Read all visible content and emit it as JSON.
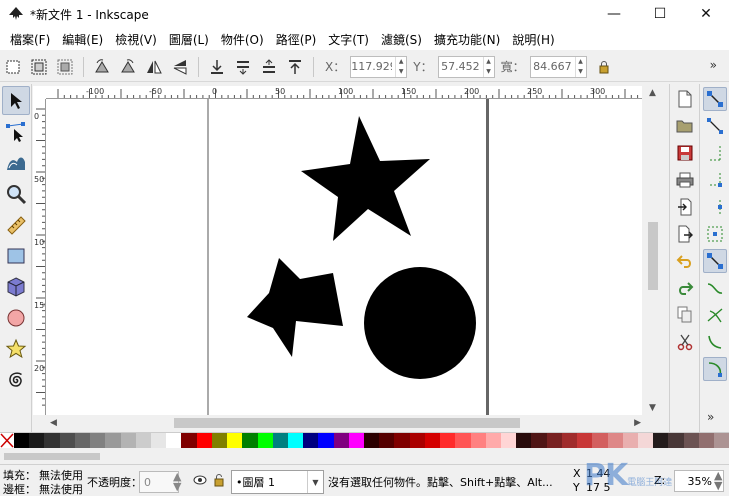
{
  "window": {
    "title": "*新文件 1 - Inkscape",
    "minimize_glyph": "—",
    "maximize_glyph": "☐",
    "close_glyph": "✕"
  },
  "menu": {
    "items": [
      {
        "label": "檔案(F)"
      },
      {
        "label": "編輯(E)"
      },
      {
        "label": "檢視(V)"
      },
      {
        "label": "圖層(L)"
      },
      {
        "label": "物件(O)"
      },
      {
        "label": "路徑(P)"
      },
      {
        "label": "文字(T)"
      },
      {
        "label": "濾鏡(S)"
      },
      {
        "label": "擴充功能(N)"
      },
      {
        "label": "說明(H)"
      }
    ]
  },
  "toolbar": {
    "x_label": "X：",
    "x_value": "117.929",
    "y_label": "Y：",
    "y_value": "57.452",
    "w_label": "寬：",
    "w_value": "84.667",
    "more": "»",
    "icons": [
      "select-all-icon",
      "select-all-layers-icon",
      "deselect-icon",
      "rotate-ccw-icon",
      "rotate-cw-icon",
      "flip-horizontal-icon",
      "flip-vertical-icon",
      "lower-to-bottom-icon",
      "lower-icon",
      "raise-icon",
      "raise-to-top-icon",
      "lock-icon"
    ]
  },
  "ruler": {
    "h_labels": [
      "-100",
      "-50",
      "0",
      "50",
      "100",
      "150",
      "200",
      "250",
      "300"
    ],
    "v_labels": [
      "0",
      "50",
      "100",
      "150",
      "200"
    ]
  },
  "tools": [
    {
      "name": "selector-tool-icon",
      "active": true
    },
    {
      "name": "node-tool-icon",
      "active": false
    },
    {
      "name": "tweak-tool-icon",
      "active": false
    },
    {
      "name": "zoom-tool-icon",
      "active": false
    },
    {
      "name": "measure-tool-icon",
      "active": false
    },
    {
      "name": "rectangle-tool-icon",
      "active": false
    },
    {
      "name": "3d-box-tool-icon",
      "active": false
    },
    {
      "name": "ellipse-tool-icon",
      "active": false
    },
    {
      "name": "star-tool-icon",
      "active": false
    },
    {
      "name": "spiral-tool-icon",
      "active": false
    }
  ],
  "commands": [
    "new-document-icon",
    "open-icon",
    "save-icon",
    "print-icon",
    "import-icon",
    "export-icon",
    "undo-icon",
    "redo-icon",
    "copy-icon",
    "cut-icon"
  ],
  "snap": [
    "snap-enable-icon",
    "snap-bbox-icon",
    "snap-bbox-edge-icon",
    "snap-bbox-corner-icon",
    "snap-bbox-midpoint-icon",
    "snap-bbox-center-icon",
    "snap-nodes-icon",
    "snap-path-icon",
    "snap-path-intersection-icon",
    "snap-cusp-icon",
    "snap-smooth-icon"
  ],
  "palette": {
    "colors": [
      "#000000",
      "#1a1a1a",
      "#333333",
      "#4d4d4d",
      "#666666",
      "#808080",
      "#999999",
      "#b3b3b3",
      "#cccccc",
      "#e6e6e6",
      "#ffffff",
      "#800000",
      "#ff0000",
      "#808000",
      "#ffff00",
      "#008000",
      "#00ff00",
      "#008080",
      "#00ffff",
      "#000080",
      "#0000ff",
      "#800080",
      "#ff00ff",
      "#2b0000",
      "#550000",
      "#800000",
      "#aa0000",
      "#d40000",
      "#ff2a2a",
      "#ff5555",
      "#ff8080",
      "#ffaaaa",
      "#ffd5d5",
      "#280b0b",
      "#501616",
      "#782121",
      "#a02c2c",
      "#c83737",
      "#d35f5f",
      "#de8787",
      "#e9afaf",
      "#f4d7d7",
      "#241c1c",
      "#483737",
      "#6c5353",
      "#916f6f",
      "#ac9393"
    ]
  },
  "status": {
    "fill_label": "填充：",
    "fill_value": "無法使用",
    "stroke_label": "邊框：",
    "stroke_value": "無法使用",
    "opacity_label": "不透明度：",
    "opacity_value": "0",
    "layer": "•圖層 1",
    "message": "沒有選取任何物件。點擊、Shift+點擊、Alt...",
    "x_label": "X",
    "x_value": "1   44",
    "y_label": "Y",
    "y_value": "17   5",
    "zoom_label": "Z:",
    "zoom_value": "35%"
  },
  "watermark": {
    "brand": "PK",
    "sub": "電腦王阿達"
  }
}
